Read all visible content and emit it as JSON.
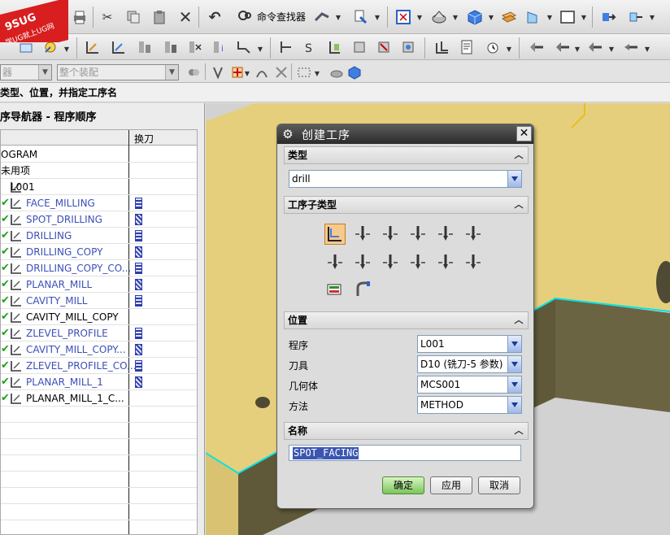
{
  "logo": {
    "top_text": "9SUG",
    "bottom_text": "学UG就上UG网"
  },
  "toolbar": {
    "command_finder_label": "命令查找器"
  },
  "filter_bar": {
    "type_filter_value": "器",
    "assembly_filter_value": "整个装配"
  },
  "cue_line": "类型、位置，并指定工序名",
  "navigator": {
    "title": "序导航器 - 程序顺序",
    "col_tool_change": "换刀",
    "rows": [
      {
        "name": "OGRAM",
        "status": "",
        "blue": false,
        "tool": false
      },
      {
        "name": "未用项",
        "status": "",
        "blue": false,
        "tool": false
      },
      {
        "name": "L001",
        "status": "",
        "blue": false,
        "tool": false
      },
      {
        "name": "FACE_MILLING",
        "status": "check",
        "blue": true,
        "tool": true
      },
      {
        "name": "SPOT_DRILLING",
        "status": "check",
        "blue": true,
        "tool": true
      },
      {
        "name": "DRILLING",
        "status": "check",
        "blue": true,
        "tool": true
      },
      {
        "name": "DRILLING_COPY",
        "status": "check",
        "blue": true,
        "tool": true
      },
      {
        "name": "DRILLING_COPY_CO...",
        "status": "check",
        "blue": true,
        "tool": true
      },
      {
        "name": "PLANAR_MILL",
        "status": "check",
        "blue": true,
        "tool": true
      },
      {
        "name": "CAVITY_MILL",
        "status": "check",
        "blue": true,
        "tool": true
      },
      {
        "name": "CAVITY_MILL_COPY",
        "status": "check",
        "blue": false,
        "tool": false
      },
      {
        "name": "ZLEVEL_PROFILE",
        "status": "check",
        "blue": true,
        "tool": true
      },
      {
        "name": "CAVITY_MILL_COPY...",
        "status": "check",
        "blue": true,
        "tool": true
      },
      {
        "name": "ZLEVEL_PROFILE_CO...",
        "status": "check",
        "blue": true,
        "tool": true
      },
      {
        "name": "PLANAR_MILL_1",
        "status": "check",
        "blue": true,
        "tool": true
      },
      {
        "name": "PLANAR_MILL_1_C...",
        "status": "check",
        "blue": false,
        "tool": false
      }
    ]
  },
  "dialog": {
    "title": "创建工序",
    "type_header": "类型",
    "type_value": "drill",
    "subtype_header": "工序子类型",
    "location_header": "位置",
    "program_label": "程序",
    "program_value": "L001",
    "tool_label": "刀具",
    "tool_value": "D10 (铣刀-5 参数)",
    "geometry_label": "几何体",
    "geometry_value": "MCS001",
    "method_label": "方法",
    "method_value": "METHOD",
    "name_header": "名称",
    "name_value": "SPOT_FACING",
    "ok_label": "确定",
    "apply_label": "应用",
    "cancel_label": "取消"
  },
  "colors": {
    "model_face": "#e6cf7c",
    "model_side": "#6b6442",
    "edge_highlight": "#00e5e5",
    "dialog_title": "#2b2b2b",
    "ok_button": "#7bc45c"
  }
}
